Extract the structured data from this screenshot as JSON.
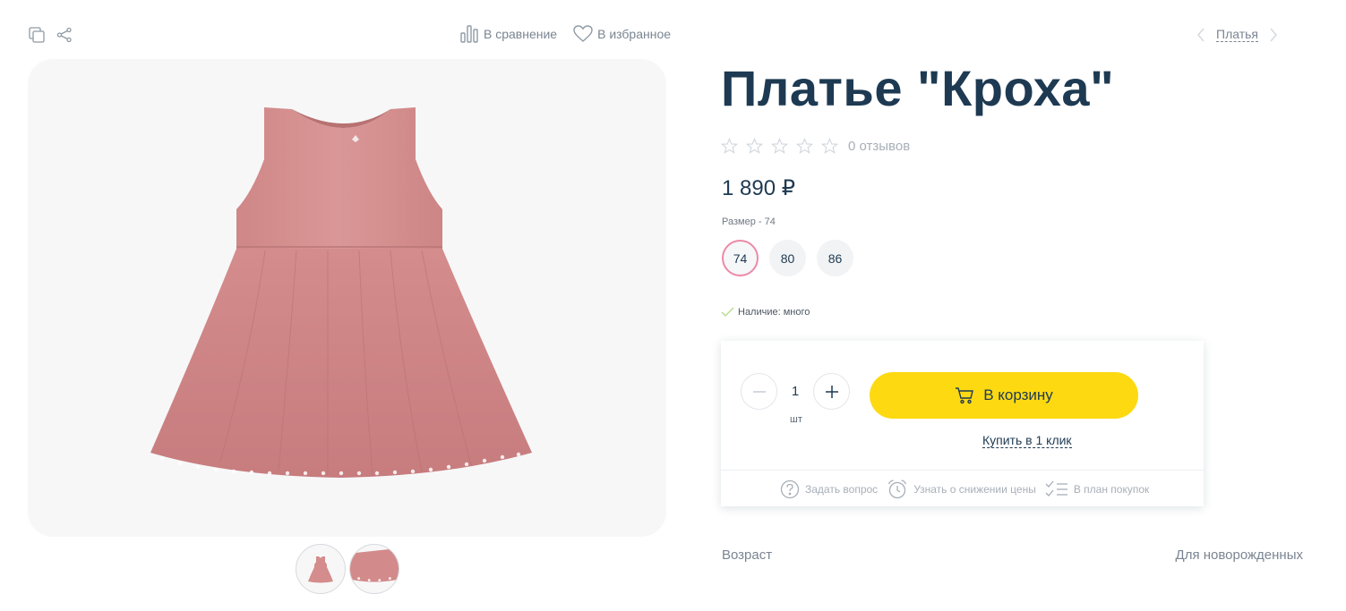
{
  "toolbar": {
    "compare_label": "В сравнение",
    "favorite_label": "В избранное"
  },
  "breadcrumb": {
    "category": "Платья"
  },
  "product": {
    "title": "Платье \"Кроха\"",
    "rating_stars": 0,
    "reviews": "0 отзывов",
    "price": "1 890 ₽",
    "size_label": "Размер - 74",
    "sizes": [
      "74",
      "80",
      "86"
    ],
    "selected_size": "74",
    "availability": "Наличие: много"
  },
  "buy_box": {
    "quantity": "1",
    "unit": "шт",
    "cart_label": "В корзину",
    "one_click_label": "Купить в 1 клик",
    "ask_question": "Задать вопрос",
    "price_drop": "Узнать о снижении цены",
    "shopping_plan": "В план покупок"
  },
  "properties": [
    {
      "name": "Возраст",
      "value": "Для новорожденных"
    }
  ],
  "colors": {
    "accent_yellow": "#fdd912",
    "selected_size_border": "#ec8aa6",
    "title": "#1e3a52",
    "dress_pink": "#d89090"
  },
  "icons": [
    "copy-icon",
    "share-icon",
    "compare-icon",
    "heart-icon",
    "chevron-left-icon",
    "chevron-right-icon",
    "star-icon",
    "check-icon",
    "minus-icon",
    "plus-icon",
    "cart-icon",
    "question-icon",
    "alarm-clock-icon",
    "checklist-icon"
  ]
}
